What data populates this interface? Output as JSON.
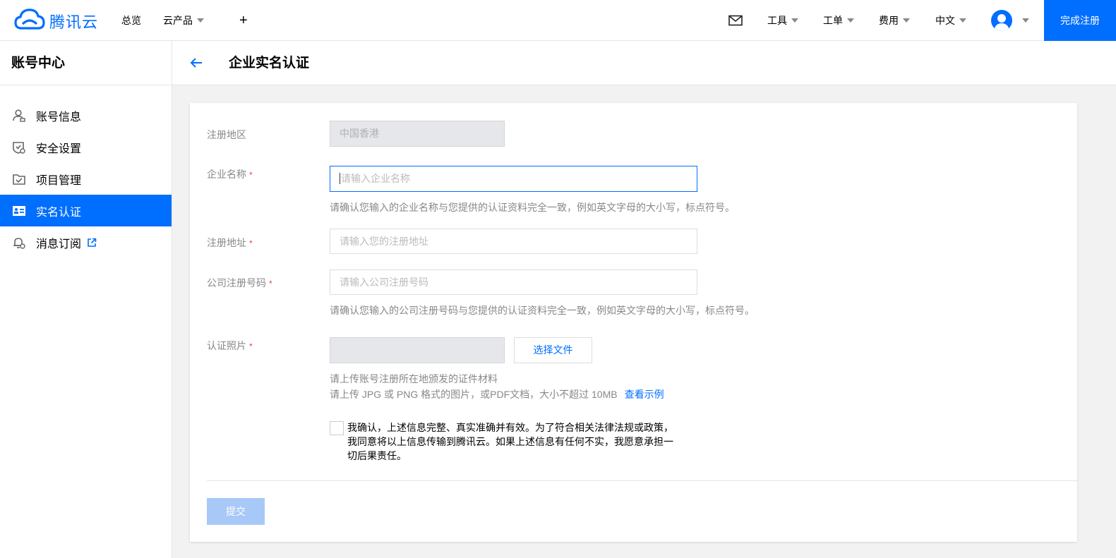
{
  "header": {
    "brand": "腾讯云",
    "nav": {
      "overview": "总览",
      "products": "云产品",
      "plus": "+"
    },
    "right": {
      "tools": "工具",
      "tickets": "工单",
      "billing": "费用",
      "language": "中文",
      "finish_registration": "完成注册"
    },
    "accent_color": "#006eff"
  },
  "sidebar": {
    "title": "账号中心",
    "items": [
      {
        "label": "账号信息",
        "icon": "user-icon"
      },
      {
        "label": "安全设置",
        "icon": "shield-icon"
      },
      {
        "label": "项目管理",
        "icon": "folder-check-icon"
      },
      {
        "label": "实名认证",
        "icon": "id-card-icon",
        "active": true
      },
      {
        "label": "消息订阅",
        "icon": "bell-settings-icon",
        "external": true
      }
    ]
  },
  "page": {
    "title": "企业实名认证"
  },
  "form": {
    "region": {
      "label": "注册地区",
      "value": "中国香港"
    },
    "company_name": {
      "label": "企业名称",
      "required": "*",
      "placeholder": "请输入企业名称",
      "hint": "请确认您输入的企业名称与您提供的认证资料完全一致，例如英文字母的大小写，标点符号。"
    },
    "address": {
      "label": "注册地址",
      "required": "*",
      "placeholder": "请输入您的注册地址"
    },
    "reg_number": {
      "label": "公司注册号码",
      "required": "*",
      "placeholder": "请输入公司注册号码",
      "hint": "请确认您输入的公司注册号码与您提供的认证资料完全一致，例如英文字母的大小写，标点符号。"
    },
    "photo": {
      "label": "认证照片",
      "required": "*",
      "button": "选择文件",
      "hint1": "请上传账号注册所在地颁发的证件材料",
      "hint2": "请上传 JPG 或 PNG 格式的图片，或PDF文档，大小不超过 10MB",
      "example_link": "查看示例"
    },
    "confirm": {
      "line1": "我确认，上述信息完整、真实准确并有效。为了符合相关法律法规或政策，",
      "line2": "我同意将以上信息传输到腾讯云。如果上述信息有任何不实，我愿意承担一",
      "line3": "切后果责任。"
    },
    "submit": "提交"
  }
}
